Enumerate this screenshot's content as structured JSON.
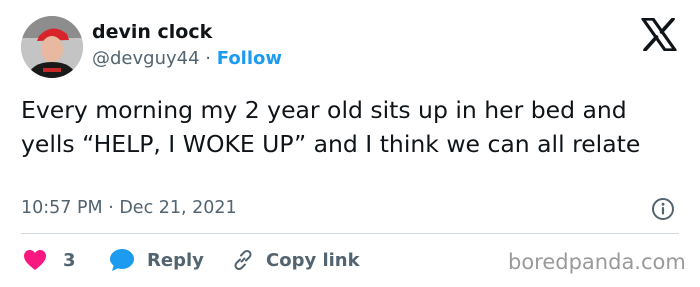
{
  "author": {
    "name": "devin clock",
    "handle": "@devguy44",
    "separator": "·",
    "follow_label": "Follow"
  },
  "platform_icon": "x-logo-icon",
  "tweet": {
    "text": "Every morning my 2 year old sits up in her bed and yells “HELP, I WOKE UP” and I think we can all relate",
    "timestamp": "10:57 PM · Dec 21, 2021"
  },
  "actions": {
    "like_count": "3",
    "reply_label": "Reply",
    "copy_label": "Copy link"
  },
  "watermark": "boredpanda.com",
  "colors": {
    "heart": "#f91880",
    "reply_bubble": "#1d9bf0",
    "follow": "#1d9bf0",
    "secondary_text": "#536471"
  }
}
